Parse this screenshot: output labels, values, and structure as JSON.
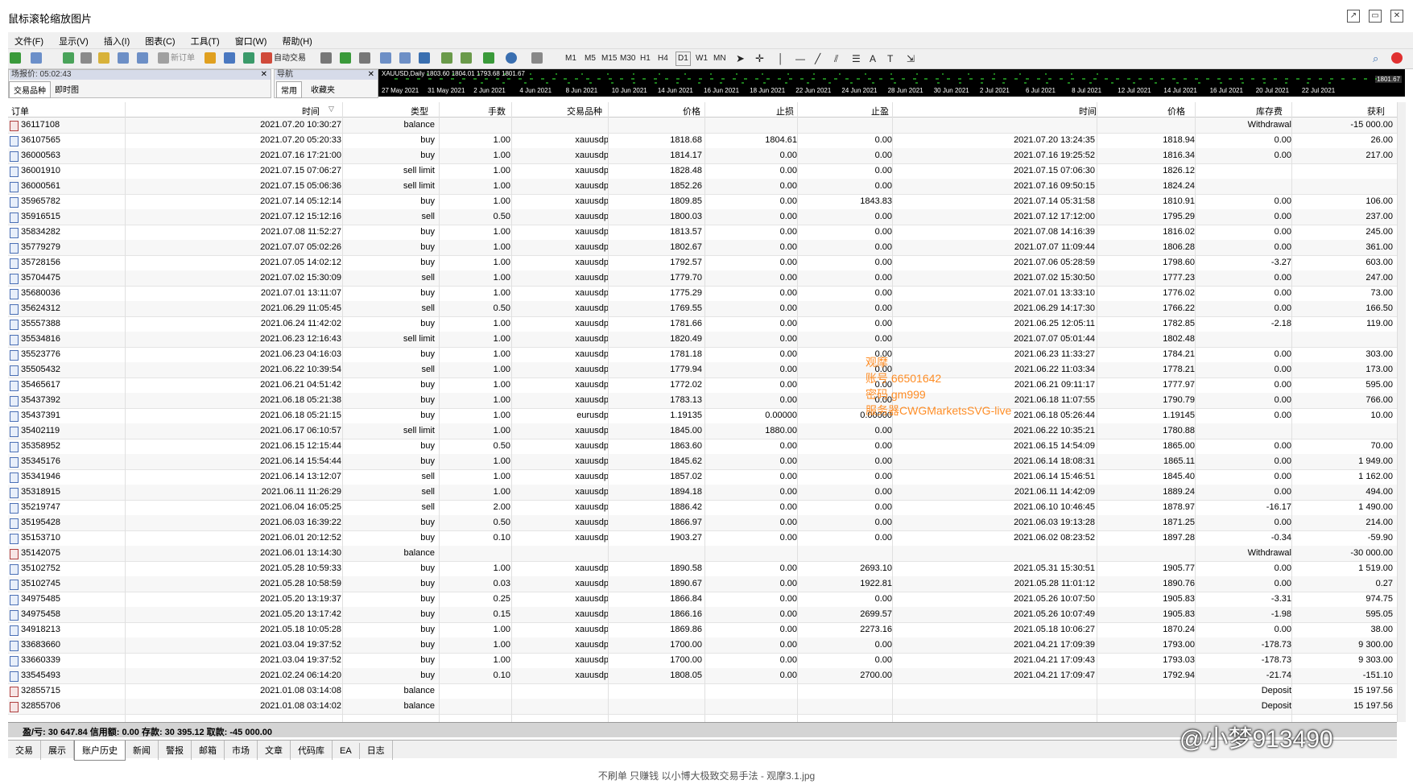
{
  "window": {
    "title": "鼠标滚轮缩放图片"
  },
  "menu": [
    "文件(F)",
    "显示(V)",
    "插入(I)",
    "图表(C)",
    "工具(T)",
    "窗口(W)",
    "帮助(H)"
  ],
  "toolbar": {
    "new_order": "新订单",
    "auto_trade": "自动交易",
    "timeframes": [
      "M1",
      "M5",
      "M15",
      "M30",
      "H1",
      "H4",
      "D1",
      "W1",
      "MN"
    ]
  },
  "quotes_panel": {
    "title": "场报价: 05:02:43",
    "tabs": [
      "交易品种",
      "即时图"
    ]
  },
  "nav_panel": {
    "title": "导航",
    "tabs": [
      "常用",
      "收藏夹"
    ]
  },
  "chart": {
    "label": "XAUUSD,Daily  1803.60 1804.01 1793.68 1801.67",
    "price": "1801.67",
    "dates": [
      "27 May 2021",
      "31 May 2021",
      "2 Jun 2021",
      "4 Jun 2021",
      "8 Jun 2021",
      "10 Jun 2021",
      "14 Jun 2021",
      "16 Jun 2021",
      "18 Jun 2021",
      "22 Jun 2021",
      "24 Jun 2021",
      "28 Jun 2021",
      "30 Jun 2021",
      "2 Jul 2021",
      "6 Jul 2021",
      "8 Jul 2021",
      "12 Jul 2021",
      "14 Jul 2021",
      "16 Jul 2021",
      "20 Jul 2021",
      "22 Jul 2021"
    ]
  },
  "columns": [
    "订单",
    "时间",
    "类型",
    "手数",
    "交易品种",
    "价格",
    "止损",
    "止盈",
    "时间",
    "价格",
    "库存费",
    "获利"
  ],
  "rows": [
    [
      "36117108",
      "2021.07.20 10:30:27",
      "balance",
      "",
      "",
      "",
      "",
      "",
      "",
      "",
      "Withdrawal",
      "-15 000.00"
    ],
    [
      "36107565",
      "2021.07.20 05:20:33",
      "buy",
      "1.00",
      "xauusdp",
      "1818.68",
      "1804.61",
      "0.00",
      "2021.07.20 13:24:35",
      "1818.94",
      "0.00",
      "26.00"
    ],
    [
      "36000563",
      "2021.07.16 17:21:00",
      "buy",
      "1.00",
      "xauusdp",
      "1814.17",
      "0.00",
      "0.00",
      "2021.07.16 19:25:52",
      "1816.34",
      "0.00",
      "217.00"
    ],
    [
      "36001910",
      "2021.07.15 07:06:27",
      "sell limit",
      "1.00",
      "xauusdp",
      "1828.48",
      "0.00",
      "0.00",
      "2021.07.15 07:06:30",
      "1826.12",
      "",
      ""
    ],
    [
      "36000561",
      "2021.07.15 05:06:36",
      "sell limit",
      "1.00",
      "xauusdp",
      "1852.26",
      "0.00",
      "0.00",
      "2021.07.16 09:50:15",
      "1824.24",
      "",
      ""
    ],
    [
      "35965782",
      "2021.07.14 05:12:14",
      "buy",
      "1.00",
      "xauusdp",
      "1809.85",
      "0.00",
      "1843.83",
      "2021.07.14 05:31:58",
      "1810.91",
      "0.00",
      "106.00"
    ],
    [
      "35916515",
      "2021.07.12 15:12:16",
      "sell",
      "0.50",
      "xauusdp",
      "1800.03",
      "0.00",
      "0.00",
      "2021.07.12 17:12:00",
      "1795.29",
      "0.00",
      "237.00"
    ],
    [
      "35834282",
      "2021.07.08 11:52:27",
      "buy",
      "1.00",
      "xauusdp",
      "1813.57",
      "0.00",
      "0.00",
      "2021.07.08 14:16:39",
      "1816.02",
      "0.00",
      "245.00"
    ],
    [
      "35779279",
      "2021.07.07 05:02:26",
      "buy",
      "1.00",
      "xauusdp",
      "1802.67",
      "0.00",
      "0.00",
      "2021.07.07 11:09:44",
      "1806.28",
      "0.00",
      "361.00"
    ],
    [
      "35728156",
      "2021.07.05 14:02:12",
      "buy",
      "1.00",
      "xauusdp",
      "1792.57",
      "0.00",
      "0.00",
      "2021.07.06 05:28:59",
      "1798.60",
      "-3.27",
      "603.00"
    ],
    [
      "35704475",
      "2021.07.02 15:30:09",
      "sell",
      "1.00",
      "xauusdp",
      "1779.70",
      "0.00",
      "0.00",
      "2021.07.02 15:30:50",
      "1777.23",
      "0.00",
      "247.00"
    ],
    [
      "35680036",
      "2021.07.01 13:11:07",
      "buy",
      "1.00",
      "xauusdp",
      "1775.29",
      "0.00",
      "0.00",
      "2021.07.01 13:33:10",
      "1776.02",
      "0.00",
      "73.00"
    ],
    [
      "35624312",
      "2021.06.29 11:05:45",
      "sell",
      "0.50",
      "xauusdp",
      "1769.55",
      "0.00",
      "0.00",
      "2021.06.29 14:17:30",
      "1766.22",
      "0.00",
      "166.50"
    ],
    [
      "35557388",
      "2021.06.24 11:42:02",
      "buy",
      "1.00",
      "xauusdp",
      "1781.66",
      "0.00",
      "0.00",
      "2021.06.25 12:05:11",
      "1782.85",
      "-2.18",
      "119.00"
    ],
    [
      "35534816",
      "2021.06.23 12:16:43",
      "sell limit",
      "1.00",
      "xauusdp",
      "1820.49",
      "0.00",
      "0.00",
      "2021.07.07 05:01:44",
      "1802.48",
      "",
      ""
    ],
    [
      "35523776",
      "2021.06.23 04:16:03",
      "buy",
      "1.00",
      "xauusdp",
      "1781.18",
      "0.00",
      "0.00",
      "2021.06.23 11:33:27",
      "1784.21",
      "0.00",
      "303.00"
    ],
    [
      "35505432",
      "2021.06.22 10:39:54",
      "sell",
      "1.00",
      "xauusdp",
      "1779.94",
      "0.00",
      "0.00",
      "2021.06.22 11:03:34",
      "1778.21",
      "0.00",
      "173.00"
    ],
    [
      "35465617",
      "2021.06.21 04:51:42",
      "buy",
      "1.00",
      "xauusdp",
      "1772.02",
      "0.00",
      "0.00",
      "2021.06.21 09:11:17",
      "1777.97",
      "0.00",
      "595.00"
    ],
    [
      "35437392",
      "2021.06.18 05:21:38",
      "buy",
      "1.00",
      "xauusdp",
      "1783.13",
      "0.00",
      "0.00",
      "2021.06.18 11:07:55",
      "1790.79",
      "0.00",
      "766.00"
    ],
    [
      "35437391",
      "2021.06.18 05:21:15",
      "buy",
      "1.00",
      "eurusdp",
      "1.19135",
      "0.00000",
      "0.00000",
      "2021.06.18 05:26:44",
      "1.19145",
      "0.00",
      "10.00"
    ],
    [
      "35402119",
      "2021.06.17 06:10:57",
      "sell limit",
      "1.00",
      "xauusdp",
      "1845.00",
      "1880.00",
      "0.00",
      "2021.06.22 10:35:21",
      "1780.88",
      "",
      ""
    ],
    [
      "35358952",
      "2021.06.15 12:15:44",
      "buy",
      "0.50",
      "xauusdp",
      "1863.60",
      "0.00",
      "0.00",
      "2021.06.15 14:54:09",
      "1865.00",
      "0.00",
      "70.00"
    ],
    [
      "35345176",
      "2021.06.14 15:54:44",
      "buy",
      "1.00",
      "xauusdp",
      "1845.62",
      "0.00",
      "0.00",
      "2021.06.14 18:08:31",
      "1865.11",
      "0.00",
      "1 949.00"
    ],
    [
      "35341946",
      "2021.06.14 13:12:07",
      "sell",
      "1.00",
      "xauusdp",
      "1857.02",
      "0.00",
      "0.00",
      "2021.06.14 15:46:51",
      "1845.40",
      "0.00",
      "1 162.00"
    ],
    [
      "35318915",
      "2021.06.11 11:26:29",
      "sell",
      "1.00",
      "xauusdp",
      "1894.18",
      "0.00",
      "0.00",
      "2021.06.11 14:42:09",
      "1889.24",
      "0.00",
      "494.00"
    ],
    [
      "35219747",
      "2021.06.04 16:05:25",
      "sell",
      "2.00",
      "xauusdp",
      "1886.42",
      "0.00",
      "0.00",
      "2021.06.10 10:46:45",
      "1878.97",
      "-16.17",
      "1 490.00"
    ],
    [
      "35195428",
      "2021.06.03 16:39:22",
      "buy",
      "0.50",
      "xauusdp",
      "1866.97",
      "0.00",
      "0.00",
      "2021.06.03 19:13:28",
      "1871.25",
      "0.00",
      "214.00"
    ],
    [
      "35153710",
      "2021.06.01 20:12:52",
      "buy",
      "0.10",
      "xauusdp",
      "1903.27",
      "0.00",
      "0.00",
      "2021.06.02 08:23:52",
      "1897.28",
      "-0.34",
      "-59.90"
    ],
    [
      "35142075",
      "2021.06.01 13:14:30",
      "balance",
      "",
      "",
      "",
      "",
      "",
      "",
      "",
      "Withdrawal",
      "-30 000.00"
    ],
    [
      "35102752",
      "2021.05.28 10:59:33",
      "buy",
      "1.00",
      "xauusdp",
      "1890.58",
      "0.00",
      "2693.10",
      "2021.05.31 15:30:51",
      "1905.77",
      "0.00",
      "1 519.00"
    ],
    [
      "35102745",
      "2021.05.28 10:58:59",
      "buy",
      "0.03",
      "xauusdp",
      "1890.67",
      "0.00",
      "1922.81",
      "2021.05.28 11:01:12",
      "1890.76",
      "0.00",
      "0.27"
    ],
    [
      "34975485",
      "2021.05.20 13:19:37",
      "buy",
      "0.25",
      "xauusdp",
      "1866.84",
      "0.00",
      "0.00",
      "2021.05.26 10:07:50",
      "1905.83",
      "-3.31",
      "974.75"
    ],
    [
      "34975458",
      "2021.05.20 13:17:42",
      "buy",
      "0.15",
      "xauusdp",
      "1866.16",
      "0.00",
      "2699.57",
      "2021.05.26 10:07:49",
      "1905.83",
      "-1.98",
      "595.05"
    ],
    [
      "34918213",
      "2021.05.18 10:05:28",
      "buy",
      "1.00",
      "xauusdp",
      "1869.86",
      "0.00",
      "2273.16",
      "2021.05.18 10:06:27",
      "1870.24",
      "0.00",
      "38.00"
    ],
    [
      "33683660",
      "2021.03.04 19:37:52",
      "buy",
      "1.00",
      "xauusdp",
      "1700.00",
      "0.00",
      "0.00",
      "2021.04.21 17:09:39",
      "1793.00",
      "-178.73",
      "9 300.00"
    ],
    [
      "33660339",
      "2021.03.04 19:37:52",
      "buy",
      "1.00",
      "xauusdp",
      "1700.00",
      "0.00",
      "0.00",
      "2021.04.21 17:09:43",
      "1793.03",
      "-178.73",
      "9 303.00"
    ],
    [
      "33545493",
      "2021.02.24 06:14:20",
      "buy",
      "0.10",
      "xauusdp",
      "1808.05",
      "0.00",
      "2700.00",
      "2021.04.21 17:09:47",
      "1792.94",
      "-21.74",
      "-151.10"
    ],
    [
      "32855715",
      "2021.01.08 03:14:08",
      "balance",
      "",
      "",
      "",
      "",
      "",
      "",
      "",
      "Deposit",
      "15 197.56"
    ],
    [
      "32855706",
      "2021.01.08 03:14:02",
      "balance",
      "",
      "",
      "",
      "",
      "",
      "",
      "",
      "Deposit",
      "15 197.56"
    ]
  ],
  "summary": "盈/亏: 30 647.84  信用额: 0.00  存款: 30 395.12  取款: -45 000.00",
  "bottom_tabs": [
    "交易",
    "展示",
    "账户历史",
    "新闻",
    "警报",
    "邮箱",
    "市场",
    "文章",
    "代码库",
    "EA",
    "日志"
  ],
  "active_tab": "账户历史",
  "watermark": [
    "观摩",
    "账号 66501642",
    "密码 gm999",
    "服务器CWGMarketsSVG-live"
  ],
  "weibo": "@小梦913490",
  "caption": "不刷单 只赚钱 以小博大极致交易手法 - 观摩3.1.jpg"
}
